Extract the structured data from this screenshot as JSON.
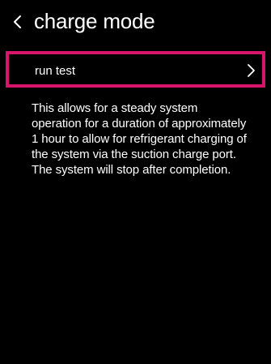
{
  "colors": {
    "background": "#000000",
    "text": "#ffffff",
    "focus_border": "#d6156b"
  },
  "header": {
    "back_icon": "chevron-left-icon",
    "title": "charge mode"
  },
  "menu": {
    "items": [
      {
        "label": "run test",
        "icon": "chevron-right-icon",
        "selected": true
      }
    ]
  },
  "description": {
    "lines": [
      "This allows for a steady system",
      "operation for a duration of approximately",
      "1 hour to allow for refrigerant charging of",
      "the system via the suction charge port.",
      "The system will stop after completion."
    ]
  }
}
